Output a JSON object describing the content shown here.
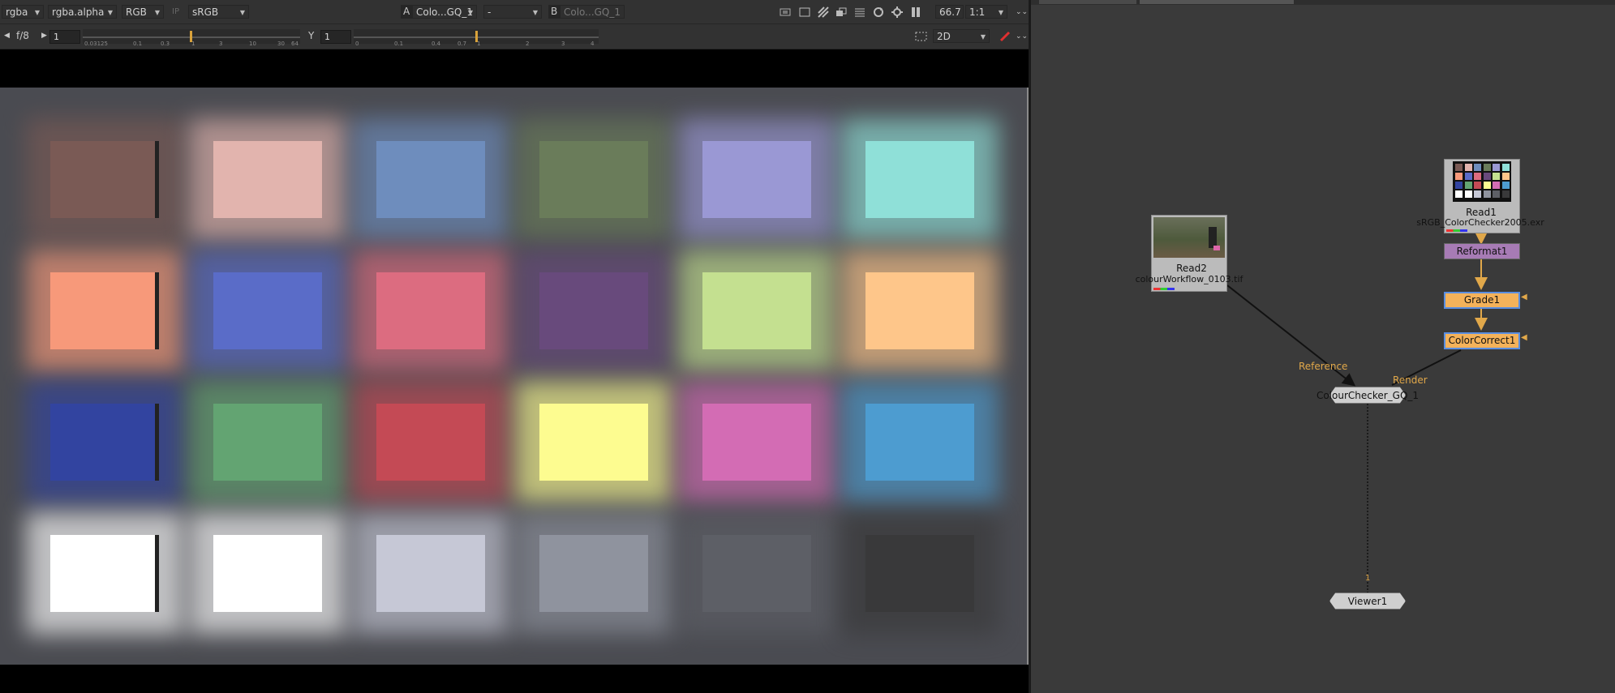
{
  "viewer": {
    "toolbar1": {
      "channels": "rgba",
      "alpha_channel": "rgba.alpha",
      "display_channels": "RGB",
      "ip_label": "IP",
      "lut": "sRGB",
      "input_a_label": "A",
      "input_a": "Colo...GQ_1",
      "blend_mode": "-",
      "input_b_label": "B",
      "input_b": "Colo...GQ_1",
      "zoom": "66.7",
      "ratio": "1:1"
    },
    "toolbar2": {
      "fstop_label": "f/8",
      "gain_value": "1",
      "gain_ticks": [
        "0.03125",
        "0.1",
        "0.3",
        "1",
        "3",
        "10",
        "30",
        "64"
      ],
      "gamma_label": "Y",
      "gamma_value": "1",
      "gamma_ticks": [
        "0",
        "0.1",
        "0.4",
        "0.7",
        "1",
        "2",
        "3",
        "4"
      ],
      "view_mode": "2D"
    },
    "chart_patches": [
      [
        "#7a5a55",
        "#e2b4ae",
        "#6e8dbd",
        "#6a7c5a",
        "#9a98d4",
        "#8fe0d8"
      ],
      [
        "#f7997a",
        "#5a6cc8",
        "#dc6c80",
        "#684a7c",
        "#c4e090",
        "#fec68a"
      ],
      [
        "#3244a0",
        "#63a472",
        "#c44a55",
        "#fdfc90",
        "#d36cb4",
        "#4d9cd0"
      ],
      [
        "#ffffff",
        "#ffffff",
        "#c6c8d6",
        "#8f939e",
        "#5d5f66",
        "#39393a"
      ]
    ]
  },
  "graph": {
    "nodes": {
      "read1": {
        "name": "Read1",
        "file": "sRGB_ColorChecker2005.exr"
      },
      "read2": {
        "name": "Read2",
        "file": "colourWorkflow_0103.tif"
      },
      "reformat": {
        "name": "Reformat1",
        "color": "#a77bb5"
      },
      "grade": {
        "name": "Grade1",
        "color": "#f4b25a"
      },
      "colorcorrect": {
        "name": "ColorCorrect1",
        "color": "#f4b25a"
      },
      "checker": {
        "name": "ColourChecker_GQ_1"
      },
      "viewer": {
        "name": "Viewer1",
        "input_number": "1"
      }
    },
    "edge_labels": {
      "reference": "Reference",
      "render": "Render"
    },
    "accent": "#e1a84a"
  }
}
